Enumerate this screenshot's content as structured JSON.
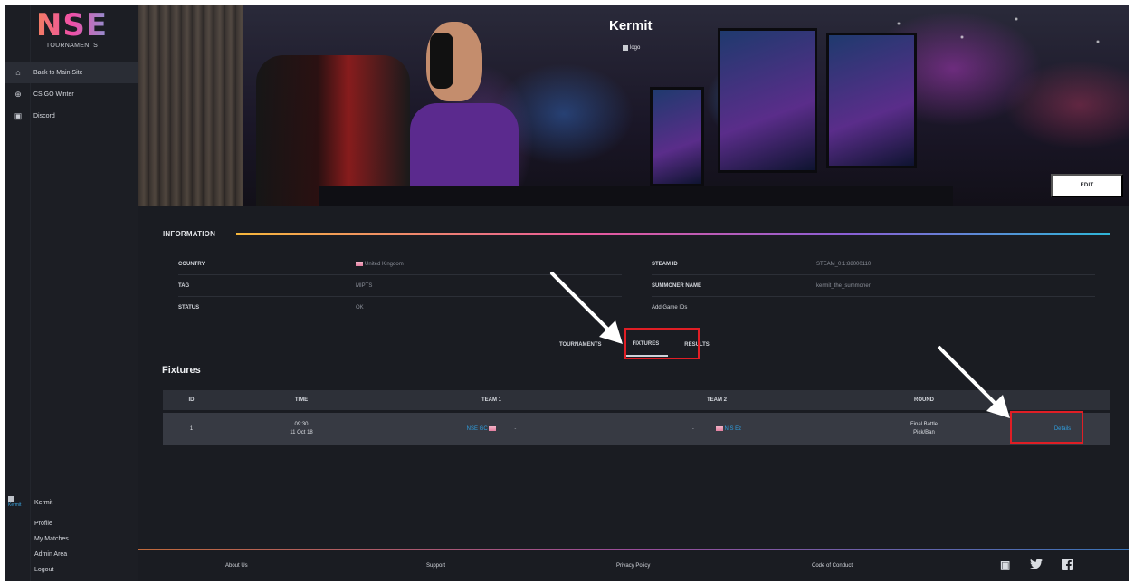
{
  "brand": {
    "logo_text": "NSE",
    "subtitle": "TOURNAMENTS"
  },
  "sidebar": {
    "items": [
      {
        "label": "Back to Main Site",
        "icon": "home-icon",
        "glyph": "⌂"
      },
      {
        "label": "CS:GO Winter",
        "icon": "globe-icon",
        "glyph": "⊕"
      },
      {
        "label": "Discord",
        "icon": "discord-icon",
        "glyph": "▣"
      }
    ],
    "user": {
      "avatar_alt": "Kermit",
      "name": "Kermit",
      "links": [
        "Profile",
        "My Matches",
        "Admin Area",
        "Logout"
      ]
    }
  },
  "hero": {
    "title": "Kermit",
    "logo_alt": "logo",
    "edit_label": "EDIT"
  },
  "information": {
    "header": "INFORMATION",
    "left": [
      {
        "key": "COUNTRY",
        "value": "United Kingdom"
      },
      {
        "key": "TAG",
        "value": "MIPTS"
      },
      {
        "key": "STATUS",
        "value": "OK"
      }
    ],
    "right": [
      {
        "key": "STEAM ID",
        "value": "STEAM_0:1:88000110"
      },
      {
        "key": "SUMMONER NAME",
        "value": "kermit_the_summoner"
      },
      {
        "key": "",
        "value": "Add Game IDs"
      }
    ]
  },
  "tabs": [
    "TOURNAMENTS",
    "FIXTURES",
    "RESULTS"
  ],
  "active_tab": "FIXTURES",
  "fixtures": {
    "title": "Fixtures",
    "columns": [
      "ID",
      "TIME",
      "TEAM 1",
      "TEAM 2",
      "ROUND",
      ""
    ],
    "rows": [
      {
        "id": "1",
        "time": "09:30",
        "date": "11 Oct 18",
        "team1": "NSE GC",
        "dash1": "-",
        "dash2": "-",
        "team2": "N S Ez",
        "round_1": "Final Battle",
        "round_2": "Pick/Ban",
        "action": "Details"
      }
    ]
  },
  "footer": {
    "links": [
      "About Us",
      "Support",
      "Privacy Policy",
      "Code of Conduct"
    ],
    "social": [
      "discord-icon",
      "twitter-icon",
      "facebook-icon"
    ]
  },
  "colors": {
    "accent_link": "#2f9fe0",
    "annotation": "#e01e25",
    "background": "#1a1c22"
  }
}
